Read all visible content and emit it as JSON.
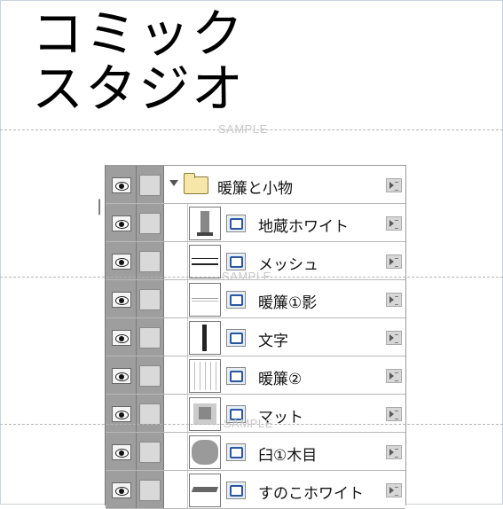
{
  "title": {
    "line1": "コミック",
    "line2": "スタジオ"
  },
  "watermark": "SAMPLE",
  "layers_panel": {
    "folder": {
      "name": "暖簾と小物",
      "expanded": true
    },
    "layers": [
      {
        "name": "地蔵ホワイト",
        "thumb": "statue"
      },
      {
        "name": "メッシュ",
        "thumb": "lines"
      },
      {
        "name": "暖簾①影",
        "thumb": "light-lines"
      },
      {
        "name": "文字",
        "thumb": "vertical-text"
      },
      {
        "name": "暖簾②",
        "thumb": "curtain"
      },
      {
        "name": "マット",
        "thumb": "mat"
      },
      {
        "name": "臼①木目",
        "thumb": "wood"
      },
      {
        "name": "すのこホワイト",
        "thumb": "slats"
      }
    ]
  },
  "colors": {
    "visibility_column": "#9e9e9e",
    "layer_icon_accent": "#2a57a0",
    "folder": "#f6e7a8"
  }
}
